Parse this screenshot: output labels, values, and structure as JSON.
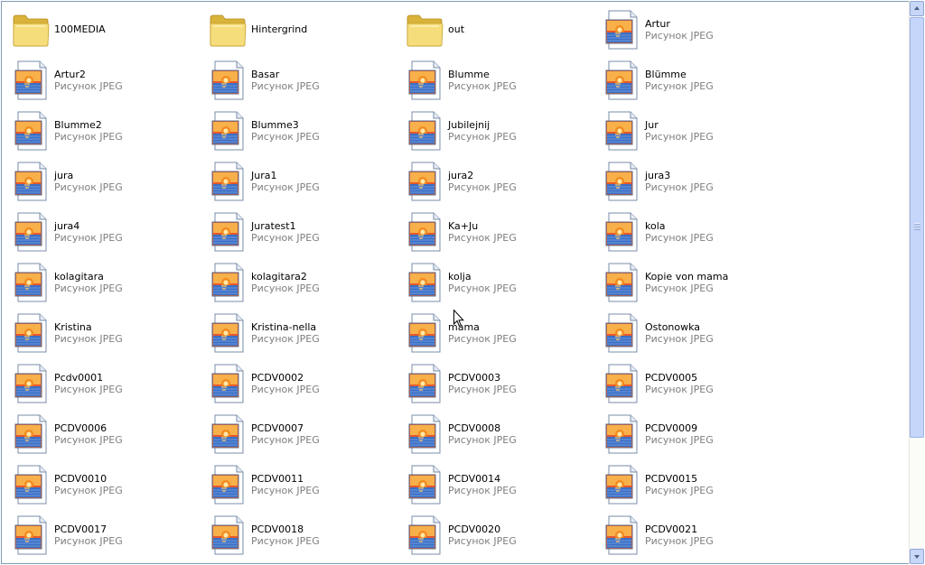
{
  "items": [
    {
      "name": "100MEDIA",
      "type": "",
      "icon": "folder-icon"
    },
    {
      "name": "Hintergrind",
      "type": "",
      "icon": "folder-icon"
    },
    {
      "name": "out",
      "type": "",
      "icon": "folder-icon"
    },
    {
      "name": "Artur",
      "type": "Рисунок JPEG",
      "icon": "jpeg-file-icon"
    },
    {
      "name": "Artur2",
      "type": "Рисунок JPEG",
      "icon": "jpeg-file-icon"
    },
    {
      "name": "Basar",
      "type": "Рисунок JPEG",
      "icon": "jpeg-file-icon"
    },
    {
      "name": "Blumme",
      "type": "Рисунок JPEG",
      "icon": "jpeg-file-icon"
    },
    {
      "name": "Blümme",
      "type": "Рисунок JPEG",
      "icon": "jpeg-file-icon"
    },
    {
      "name": "Blumme2",
      "type": "Рисунок JPEG",
      "icon": "jpeg-file-icon"
    },
    {
      "name": "Blumme3",
      "type": "Рисунок JPEG",
      "icon": "jpeg-file-icon"
    },
    {
      "name": "Jubilejnij",
      "type": "Рисунок JPEG",
      "icon": "jpeg-file-icon"
    },
    {
      "name": "Jur",
      "type": "Рисунок JPEG",
      "icon": "jpeg-file-icon"
    },
    {
      "name": "jura",
      "type": "Рисунок JPEG",
      "icon": "jpeg-file-icon"
    },
    {
      "name": "Jura1",
      "type": "Рисунок JPEG",
      "icon": "jpeg-file-icon"
    },
    {
      "name": "jura2",
      "type": "Рисунок JPEG",
      "icon": "jpeg-file-icon"
    },
    {
      "name": "jura3",
      "type": "Рисунок JPEG",
      "icon": "jpeg-file-icon"
    },
    {
      "name": "jura4",
      "type": "Рисунок JPEG",
      "icon": "jpeg-file-icon"
    },
    {
      "name": "Juratest1",
      "type": "Рисунок JPEG",
      "icon": "jpeg-file-icon"
    },
    {
      "name": "Ka+Ju",
      "type": "Рисунок JPEG",
      "icon": "jpeg-file-icon"
    },
    {
      "name": "kola",
      "type": "Рисунок JPEG",
      "icon": "jpeg-file-icon"
    },
    {
      "name": "kolagitara",
      "type": "Рисунок JPEG",
      "icon": "jpeg-file-icon"
    },
    {
      "name": "kolagitara2",
      "type": "Рисунок JPEG",
      "icon": "jpeg-file-icon"
    },
    {
      "name": "kolja",
      "type": "Рисунок JPEG",
      "icon": "jpeg-file-icon"
    },
    {
      "name": "Kopie von mama",
      "type": "Рисунок JPEG",
      "icon": "jpeg-file-icon"
    },
    {
      "name": "Kristina",
      "type": "Рисунок JPEG",
      "icon": "jpeg-file-icon"
    },
    {
      "name": "Kristina-nella",
      "type": "Рисунок JPEG",
      "icon": "jpeg-file-icon"
    },
    {
      "name": "mama",
      "type": "Рисунок JPEG",
      "icon": "jpeg-file-icon"
    },
    {
      "name": "Ostonowka",
      "type": "Рисунок JPEG",
      "icon": "jpeg-file-icon"
    },
    {
      "name": "Pcdv0001",
      "type": "Рисунок JPEG",
      "icon": "jpeg-file-icon"
    },
    {
      "name": "PCDV0002",
      "type": "Рисунок JPEG",
      "icon": "jpeg-file-icon"
    },
    {
      "name": "PCDV0003",
      "type": "Рисунок JPEG",
      "icon": "jpeg-file-icon"
    },
    {
      "name": "PCDV0005",
      "type": "Рисунок JPEG",
      "icon": "jpeg-file-icon"
    },
    {
      "name": "PCDV0006",
      "type": "Рисунок JPEG",
      "icon": "jpeg-file-icon"
    },
    {
      "name": "PCDV0007",
      "type": "Рисунок JPEG",
      "icon": "jpeg-file-icon"
    },
    {
      "name": "PCDV0008",
      "type": "Рисунок JPEG",
      "icon": "jpeg-file-icon"
    },
    {
      "name": "PCDV0009",
      "type": "Рисунок JPEG",
      "icon": "jpeg-file-icon"
    },
    {
      "name": "PCDV0010",
      "type": "Рисунок JPEG",
      "icon": "jpeg-file-icon"
    },
    {
      "name": "PCDV0011",
      "type": "Рисунок JPEG",
      "icon": "jpeg-file-icon"
    },
    {
      "name": "PCDV0014",
      "type": "Рисунок JPEG",
      "icon": "jpeg-file-icon"
    },
    {
      "name": "PCDV0015",
      "type": "Рисунок JPEG",
      "icon": "jpeg-file-icon"
    },
    {
      "name": "PCDV0017",
      "type": "Рисунок JPEG",
      "icon": "jpeg-file-icon"
    },
    {
      "name": "PCDV0018",
      "type": "Рисунок JPEG",
      "icon": "jpeg-file-icon"
    },
    {
      "name": "PCDV0020",
      "type": "Рисунок JPEG",
      "icon": "jpeg-file-icon"
    },
    {
      "name": "PCDV0021",
      "type": "Рисунок JPEG",
      "icon": "jpeg-file-icon"
    }
  ],
  "colors": {
    "folder_fill": "#f6dd7c",
    "folder_dark": "#d9b33a",
    "photo_sun": "#f38a1e",
    "photo_sky": "#e9582a",
    "photo_water": "#3b6fc4",
    "type_text": "#7f7f7f"
  }
}
